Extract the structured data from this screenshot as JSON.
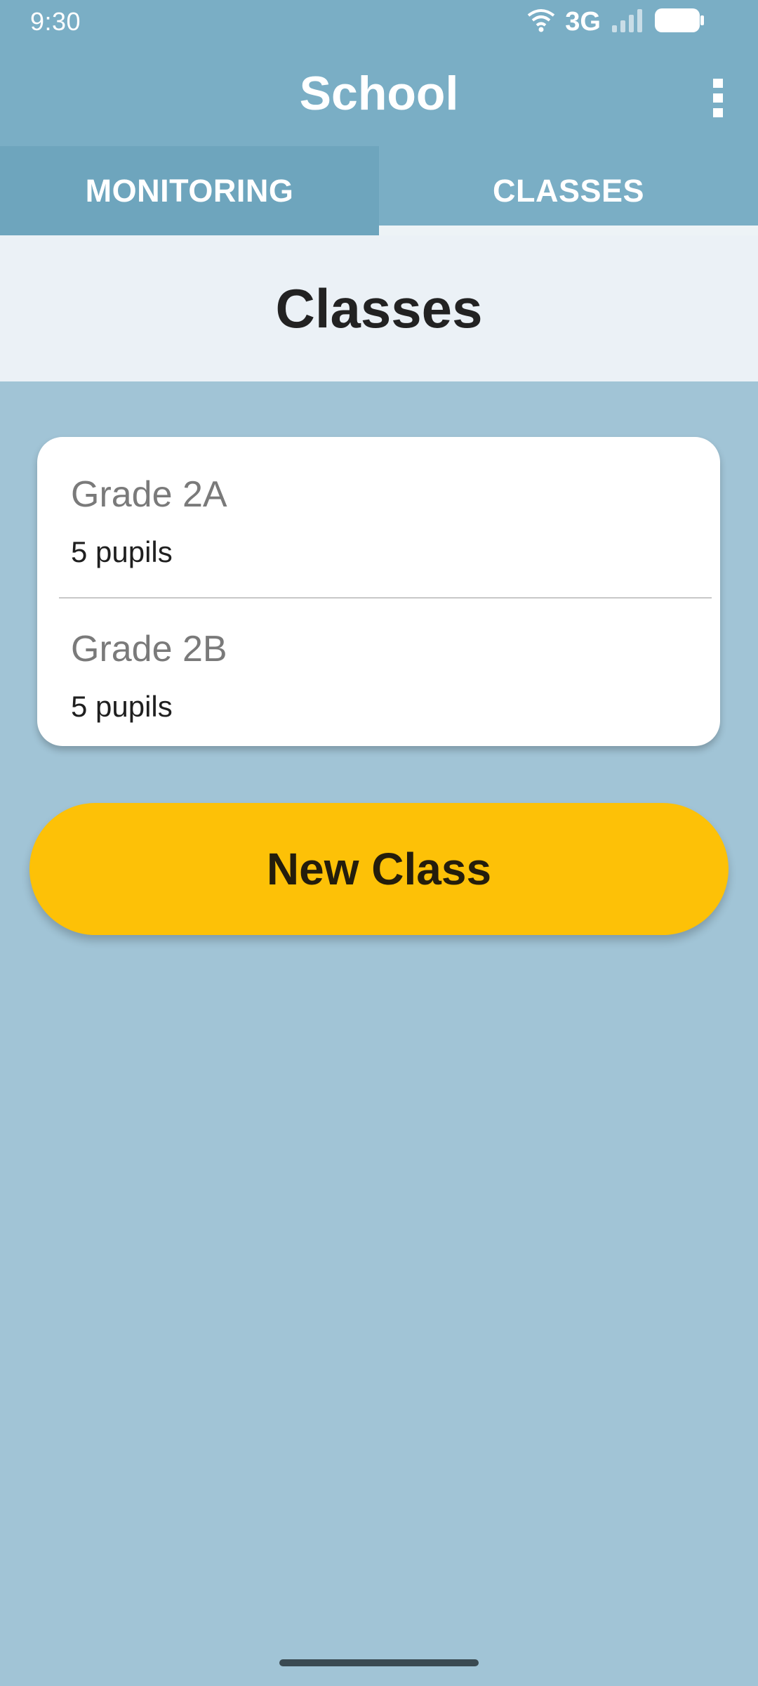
{
  "status_bar": {
    "time": "9:30",
    "network": "3G",
    "icons": [
      "wifi-icon",
      "signal-icon",
      "battery-icon"
    ]
  },
  "app_bar": {
    "title": "School",
    "menu_icon": "more-vert-icon"
  },
  "tabs": [
    {
      "label": "MONITORING",
      "selected": false
    },
    {
      "label": "CLASSES",
      "selected": true
    }
  ],
  "page": {
    "title": "Classes"
  },
  "classes": [
    {
      "name": "Grade 2A",
      "count": "5 pupils"
    },
    {
      "name": "Grade 2B",
      "count": "5 pupils"
    }
  ],
  "actions": {
    "new_class": "New Class"
  },
  "colors": {
    "app_bar": "#7aaec5",
    "background": "#a1c4d6",
    "header_band": "#ebf1f6",
    "accent_button": "#fdc107"
  }
}
